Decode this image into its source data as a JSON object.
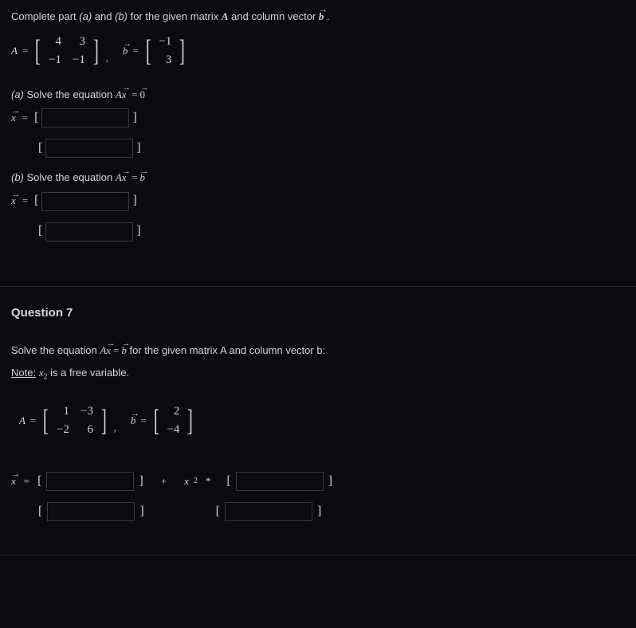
{
  "q6": {
    "intro_pre": "Complete part ",
    "intro_a": "(a)",
    "intro_mid": " and ",
    "intro_b": "(b)",
    "intro_post": " for the given matrix ",
    "intro_end": " and column vector ",
    "dot": " .",
    "A_label": "A",
    "eq": "=",
    "comma": ",",
    "b_label": "b",
    "matA": [
      [
        "4",
        "3"
      ],
      [
        "−1",
        "−1"
      ]
    ],
    "vecb": [
      "−1",
      "3"
    ],
    "part_a_label": "(a)",
    "part_a_text": "  Solve the equation  ",
    "Ax_A": "A",
    "Ax_x": "x",
    "zero": "0",
    "x_var": "x",
    "lbracket": "[",
    "rbracket": "]",
    "part_b_label": "(b)",
    "part_b_text": "  Solve the equation  "
  },
  "q7": {
    "title": "Question 7",
    "instr_pre": "Solve the equation  ",
    "instr_post": "  for the given matrix A and column vector b:",
    "note_label": "Note:",
    "note_text": " is a free variable.",
    "x2": "x",
    "x2_sub": "2",
    "matA": [
      [
        "1",
        "−3"
      ],
      [
        "−2",
        "6"
      ]
    ],
    "vecb": [
      "2",
      "−4"
    ],
    "plus": "+",
    "mult": "*"
  }
}
